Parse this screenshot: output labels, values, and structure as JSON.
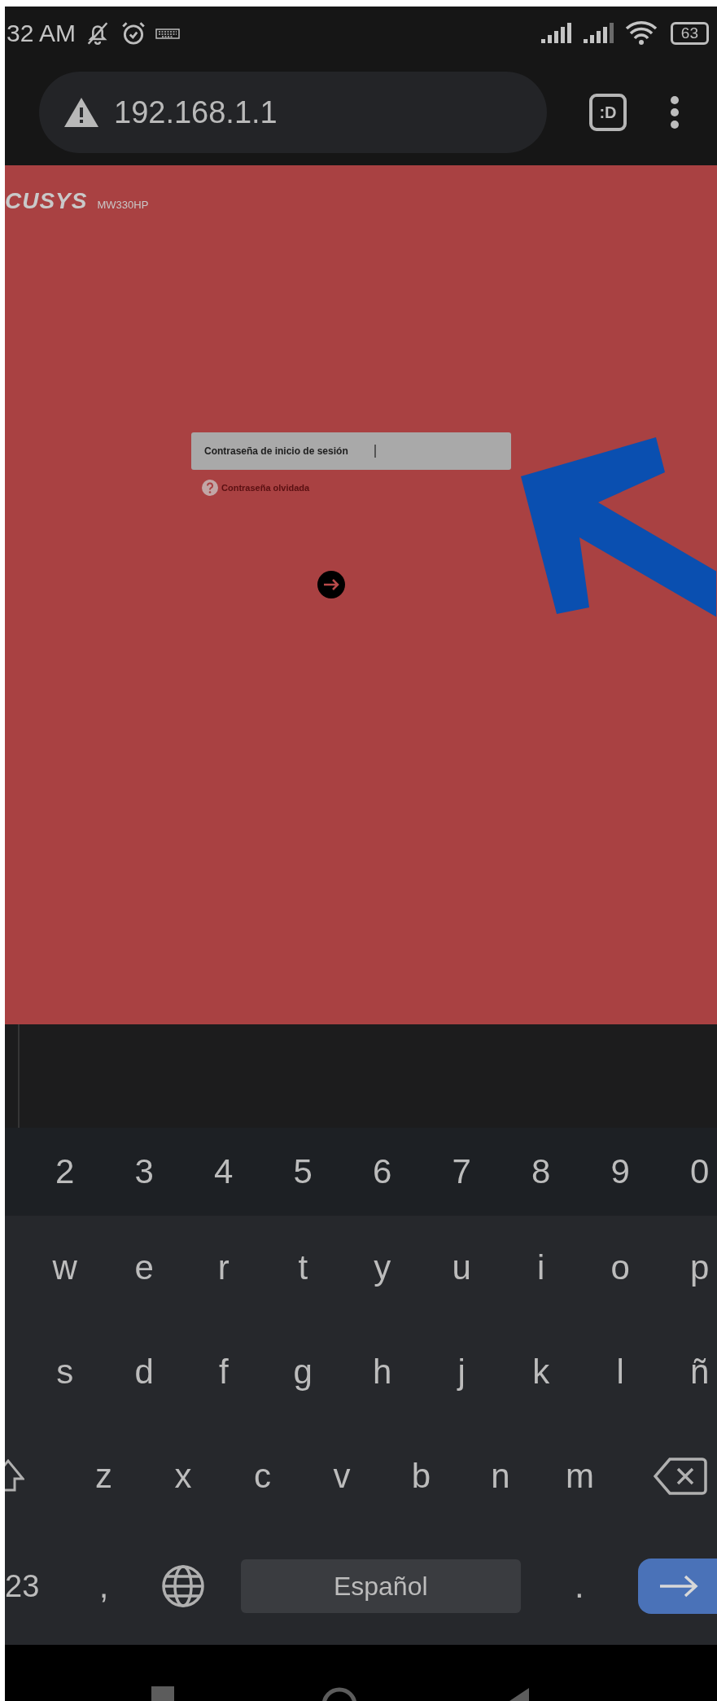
{
  "status_bar": {
    "time": "32 AM",
    "battery": "63"
  },
  "browser": {
    "url": "192.168.1.1",
    "tab_button": ":D"
  },
  "page": {
    "brand": "CUSYS",
    "model": "MW330HP",
    "password_field": {
      "label": "Contraseña de inicio de sesión",
      "focused": true
    },
    "forgot_link": "Contraseña olvidada"
  },
  "keyboard": {
    "rows": [
      {
        "kind": "digits",
        "keys": [
          "2",
          "3",
          "4",
          "5",
          "6",
          "7",
          "8",
          "9",
          "0"
        ]
      },
      {
        "kind": "letters",
        "keys": [
          "w",
          "e",
          "r",
          "t",
          "y",
          "u",
          "i",
          "o",
          "p"
        ]
      },
      {
        "kind": "letters",
        "keys": [
          "s",
          "d",
          "f",
          "g",
          "h",
          "j",
          "k",
          "l",
          "ñ"
        ]
      },
      {
        "kind": "shift_row",
        "keys": [
          "z",
          "x",
          "c",
          "v",
          "b",
          "n",
          "m"
        ]
      }
    ],
    "bottom": {
      "symbols_key": "23",
      "comma": ",",
      "space": "Español",
      "period": "."
    }
  }
}
